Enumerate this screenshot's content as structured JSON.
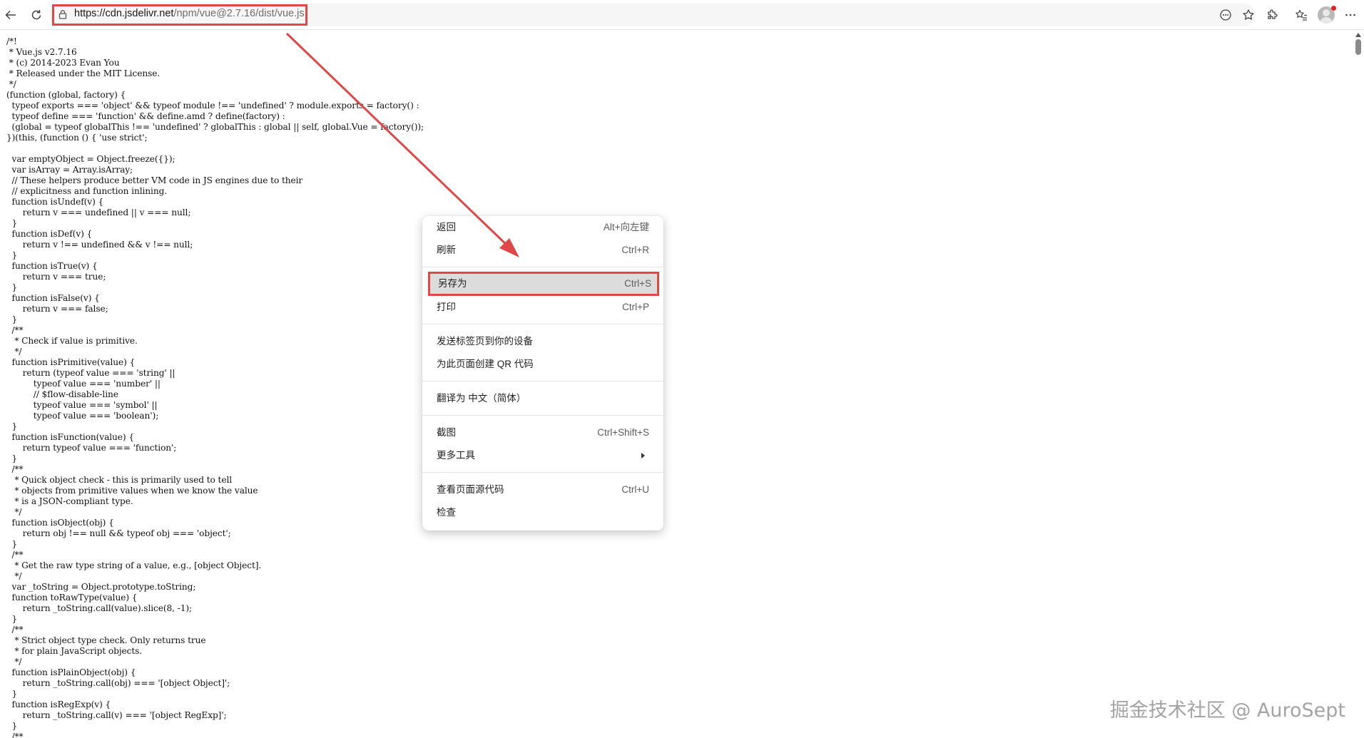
{
  "browser": {
    "url": "https://cdn.jsdelivr.net/npm/vue@2.7.16/dist/vue.js",
    "url_host": "https://cdn.jsdelivr.net",
    "url_path": "/npm/vue@2.7.16/dist/vue.js"
  },
  "code": "/*!\n * Vue.js v2.7.16\n * (c) 2014-2023 Evan You\n * Released under the MIT License.\n */\n(function (global, factory) {\n  typeof exports === 'object' && typeof module !== 'undefined' ? module.exports = factory() :\n  typeof define === 'function' && define.amd ? define(factory) :\n  (global = typeof globalThis !== 'undefined' ? globalThis : global || self, global.Vue = factory());\n})(this, (function () { 'use strict';\n\n  var emptyObject = Object.freeze({});\n  var isArray = Array.isArray;\n  // These helpers produce better VM code in JS engines due to their\n  // explicitness and function inlining.\n  function isUndef(v) {\n      return v === undefined || v === null;\n  }\n  function isDef(v) {\n      return v !== undefined && v !== null;\n  }\n  function isTrue(v) {\n      return v === true;\n  }\n  function isFalse(v) {\n      return v === false;\n  }\n  /**\n   * Check if value is primitive.\n   */\n  function isPrimitive(value) {\n      return (typeof value === 'string' ||\n          typeof value === 'number' ||\n          // $flow-disable-line\n          typeof value === 'symbol' ||\n          typeof value === 'boolean');\n  }\n  function isFunction(value) {\n      return typeof value === 'function';\n  }\n  /**\n   * Quick object check - this is primarily used to tell\n   * objects from primitive values when we know the value\n   * is a JSON-compliant type.\n   */\n  function isObject(obj) {\n      return obj !== null && typeof obj === 'object';\n  }\n  /**\n   * Get the raw type string of a value, e.g., [object Object].\n   */\n  var _toString = Object.prototype.toString;\n  function toRawType(value) {\n      return _toString.call(value).slice(8, -1);\n  }\n  /**\n   * Strict object type check. Only returns true\n   * for plain JavaScript objects.\n   */\n  function isPlainObject(obj) {\n      return _toString.call(obj) === '[object Object]';\n  }\n  function isRegExp(v) {\n      return _toString.call(v) === '[object RegExp]';\n  }\n  /**",
  "context_menu": {
    "back": {
      "label": "返回",
      "shortcut": "Alt+向左键"
    },
    "refresh": {
      "label": "刷新",
      "shortcut": "Ctrl+R"
    },
    "save_as": {
      "label": "另存为",
      "shortcut": "Ctrl+S"
    },
    "print": {
      "label": "打印",
      "shortcut": "Ctrl+P"
    },
    "send_tab": {
      "label": "发送标签页到你的设备"
    },
    "create_qr": {
      "label": "为此页面创建 QR 代码"
    },
    "translate": {
      "label": "翻译为 中文（简体）"
    },
    "screenshot": {
      "label": "截图",
      "shortcut": "Ctrl+Shift+S"
    },
    "more_tools": {
      "label": "更多工具"
    },
    "view_source": {
      "label": "查看页面源代码",
      "shortcut": "Ctrl+U"
    },
    "inspect": {
      "label": "检查"
    }
  },
  "watermark": "掘金技术社区 @ AuroSept",
  "colors": {
    "annotation_red": "#e04848",
    "menu_highlight": "#dcdcdc"
  },
  "icons": [
    "back-arrow-icon",
    "refresh-icon",
    "lock-icon",
    "reading-icon",
    "favorite-star-icon",
    "extensions-icon",
    "favorites-icon",
    "profile-icon",
    "more-icon"
  ]
}
